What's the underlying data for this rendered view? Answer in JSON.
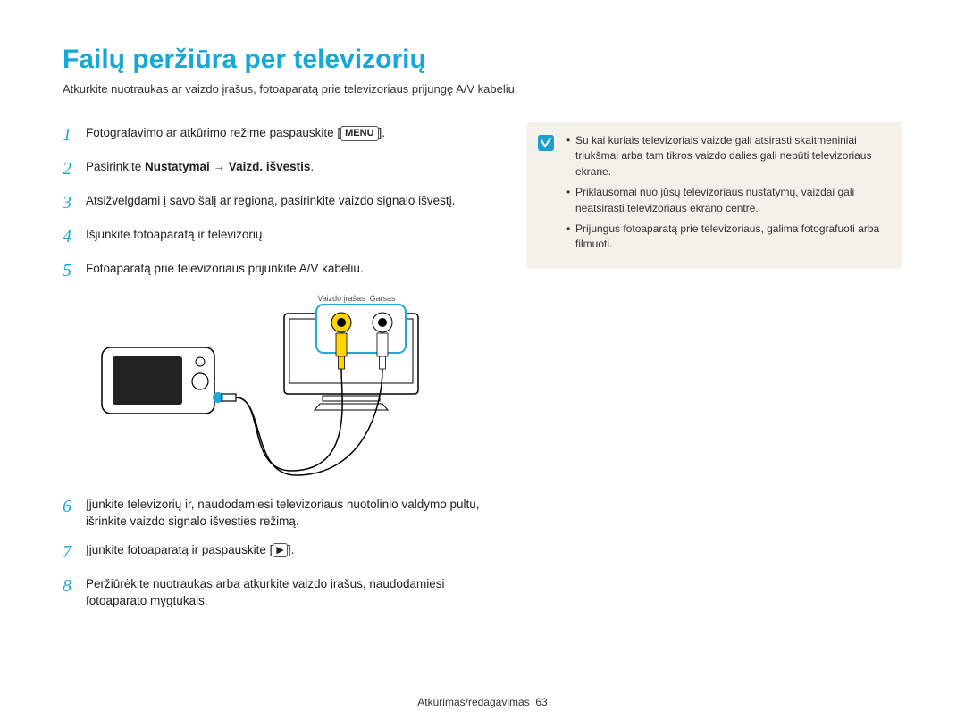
{
  "title": "Failų peržiūra per televizorių",
  "intro": "Atkurkite nuotraukas ar vaizdo įrašus, fotoaparatą prie televizoriaus prijungę A/V kabeliu.",
  "steps": {
    "s1_pre": "Fotografavimo ar atkūrimo režime paspauskite [",
    "s1_menu": "MENU",
    "s1_post": "].",
    "s2_pre": "Pasirinkite ",
    "s2_bold": "Nustatymai → Vaizd. išvestis",
    "s2_post": ".",
    "s3": "Atsižvelgdami į savo šalį ar regioną, pasirinkite vaizdo signalo išvestį.",
    "s4": "Išjunkite fotoaparatą ir televizorių.",
    "s5": "Fotoaparatą prie televizoriaus prijunkite A/V kabeliu.",
    "s6": "Įjunkite televizorių ir, naudodamiesi televizoriaus nuotolinio valdymo pultu, išrinkite vaizdo signalo išvesties režimą.",
    "s7_pre": "Įjunkite fotoaparatą ir paspauskite [",
    "s7_icon": "▶",
    "s7_post": "].",
    "s8": "Peržiūrėkite nuotraukas arba atkurkite vaizdo įrašus, naudodamiesi fotoaparato mygtukais."
  },
  "diagram": {
    "video_label": "Vaizdo įrašas",
    "audio_label": "Garsas"
  },
  "notes": {
    "n1": "Su kai kuriais televizoriais vaizde gali atsirasti skaitmeniniai triukšmai arba tam tikros vaizdo dalies gali nebūti televizoriaus ekrane.",
    "n2": "Priklausomai nuo jūsų televizoriaus nustatymų, vaizdai gali neatsirasti televizoriaus ekrano centre.",
    "n3": "Prijungus fotoaparatą prie televizoriaus, galima fotografuoti arba filmuoti."
  },
  "footer_label": "Atkūrimas/redagavimas",
  "footer_page": "63"
}
